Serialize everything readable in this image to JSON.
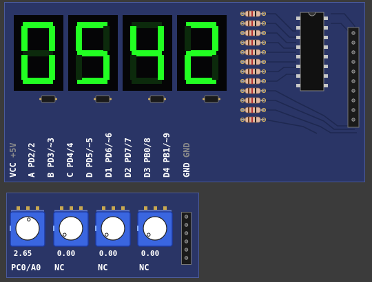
{
  "display": {
    "digits": [
      "0",
      "5",
      "4",
      "2"
    ],
    "segment_on_color": "#22ff22",
    "segment_off_color": "#0c2a0c"
  },
  "pins": [
    {
      "name": "VCC",
      "sub": "+5V"
    },
    {
      "name": "A",
      "sub": "PD2/2"
    },
    {
      "name": "B",
      "sub": "PD3/~3"
    },
    {
      "name": "C",
      "sub": "PD4/4"
    },
    {
      "name": "D",
      "sub": "PD5/~5"
    },
    {
      "name": "D1",
      "sub": "PD6/~6"
    },
    {
      "name": "D2",
      "sub": "PD7/7"
    },
    {
      "name": "D3",
      "sub": "PB0/8"
    },
    {
      "name": "D4",
      "sub": "PB1/~9"
    },
    {
      "name": "GND",
      "sub": "GND"
    }
  ],
  "pots": [
    {
      "value": "2.65",
      "label": "PC0/A0",
      "level": 0.53
    },
    {
      "value": "0.00",
      "label": "NC",
      "level": 0
    },
    {
      "value": "0.00",
      "label": "NC",
      "level": 0
    },
    {
      "value": "0.00",
      "label": "NC",
      "level": 0
    }
  ]
}
